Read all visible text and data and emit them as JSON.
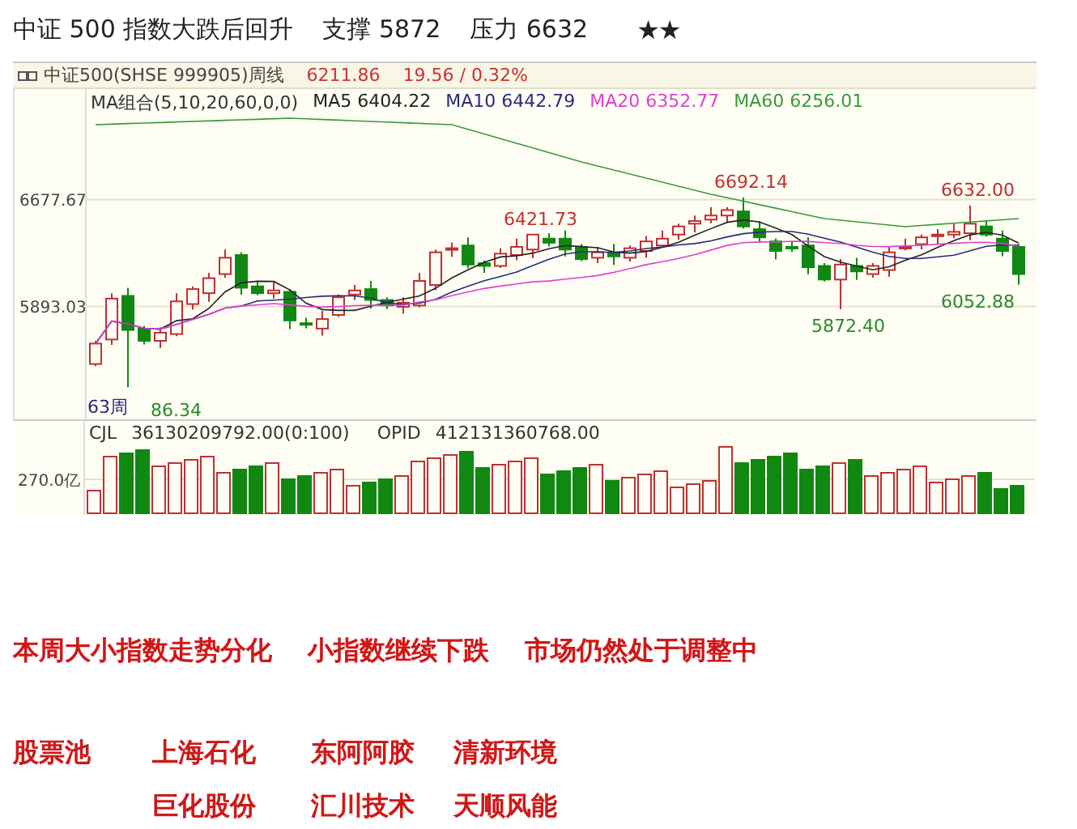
{
  "title": {
    "parts": [
      "中证 500 指数大跌后回升",
      "支撑 5872",
      "压力 6632"
    ],
    "rating": "★★"
  },
  "chart": {
    "header": {
      "name": "中证500(SHSE 999905)周线",
      "price": "6211.86",
      "change": "19.56 / 0.32%"
    },
    "ma_combo": "MA组合(5,10,20,60,0,0)",
    "ma_lines": [
      {
        "label": "MA5 6404.22",
        "color": "#222222"
      },
      {
        "label": "MA10 6442.79",
        "color": "#2a2a7a"
      },
      {
        "label": "MA20 6352.77",
        "color": "#e040d0"
      },
      {
        "label": "MA60 6256.01",
        "color": "#3a9a3a"
      }
    ],
    "yticks": [
      "6677.67",
      "5893.03"
    ],
    "annotations": [
      {
        "text": "6421.73",
        "kind": "high"
      },
      {
        "text": "6692.14",
        "kind": "high"
      },
      {
        "text": "6632.00",
        "kind": "high"
      },
      {
        "text": "5872.40",
        "kind": "low"
      },
      {
        "text": "6052.88",
        "kind": "low"
      },
      {
        "text": "86.34",
        "kind": "low"
      }
    ],
    "period_label": "63周",
    "volume": {
      "label": "CJL",
      "value": "36130209792.00(0:100)",
      "label_2": "OPID",
      "value_2": "412131360768.00",
      "ytick": "270.0亿"
    }
  },
  "headline": [
    "本周大小指数走势分化",
    "小指数继续下跌",
    "市场仍然处于调整中"
  ],
  "stock_pool": {
    "label": "股票池",
    "stocks": [
      "上海石化",
      "东阿阿胶",
      "清新环境",
      "巨化股份",
      "汇川技术",
      "天顺风能"
    ]
  }
}
